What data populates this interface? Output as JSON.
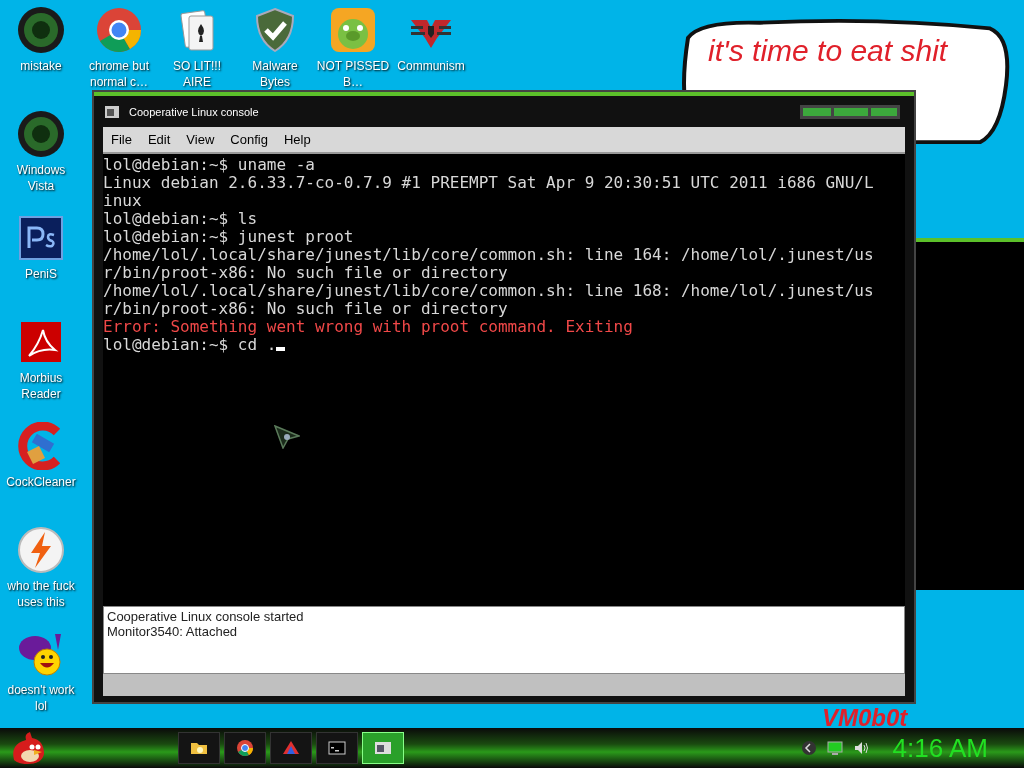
{
  "desktop": {
    "top_icons": [
      {
        "label": "mistake",
        "kind": "orb"
      },
      {
        "label": "chrome but normal c…",
        "kind": "chrome"
      },
      {
        "label": "SO LIT!!! AIRE",
        "kind": "cards"
      },
      {
        "label": "Malware Bytes",
        "kind": "shield"
      },
      {
        "label": "NOT PISSED B…",
        "kind": "pig"
      },
      {
        "label": "Communism",
        "kind": "emblem"
      }
    ],
    "left_icons": [
      {
        "label": "Windows Vista",
        "kind": "orb"
      },
      {
        "label": "PeniS",
        "kind": "ps"
      },
      {
        "label": "Morbius Reader",
        "kind": "pdf"
      },
      {
        "label": "CockCleaner",
        "kind": "cleaner"
      },
      {
        "label": "who the fuck uses this",
        "kind": "bolt"
      },
      {
        "label": "doesn't work lol",
        "kind": "yahoo"
      }
    ],
    "bubble_text": "it's time to eat shit",
    "wallpaper_text": "VM0b0t"
  },
  "window": {
    "title": "Cooperative Linux console",
    "menu": [
      "File",
      "Edit",
      "View",
      "Config",
      "Help"
    ],
    "terminal": {
      "lines": [
        {
          "text": "lol@debian:~$ uname -a",
          "kind": "normal"
        },
        {
          "text": "Linux debian 2.6.33.7-co-0.7.9 #1 PREEMPT Sat Apr 9 20:30:51 UTC 2011 i686 GNU/L",
          "kind": "normal"
        },
        {
          "text": "inux",
          "kind": "normal"
        },
        {
          "text": "lol@debian:~$ ls",
          "kind": "normal"
        },
        {
          "text": "lol@debian:~$ junest proot",
          "kind": "normal"
        },
        {
          "text": "/home/lol/.local/share/junest/lib/core/common.sh: line 164: /home/lol/.junest/us",
          "kind": "normal"
        },
        {
          "text": "r/bin/proot-x86: No such file or directory",
          "kind": "normal"
        },
        {
          "text": "/home/lol/.local/share/junest/lib/core/common.sh: line 168: /home/lol/.junest/us",
          "kind": "normal"
        },
        {
          "text": "r/bin/proot-x86: No such file or directory",
          "kind": "normal"
        },
        {
          "text": "Error: Something went wrong with proot command. Exiting",
          "kind": "error"
        },
        {
          "text": "lol@debian:~$ cd .",
          "kind": "normal"
        }
      ],
      "cursor": true
    },
    "log": [
      "Cooperative Linux console started",
      "Monitor3540: Attached"
    ]
  },
  "taskbar": {
    "apps": [
      {
        "kind": "folder",
        "selected": false
      },
      {
        "kind": "chrome",
        "selected": false
      },
      {
        "kind": "paint",
        "selected": false
      },
      {
        "kind": "cmd",
        "selected": false
      },
      {
        "kind": "console",
        "selected": true
      }
    ],
    "tray": [
      {
        "kind": "chevron"
      },
      {
        "kind": "monitor"
      },
      {
        "kind": "speaker"
      }
    ],
    "clock": "4:16 AM"
  }
}
